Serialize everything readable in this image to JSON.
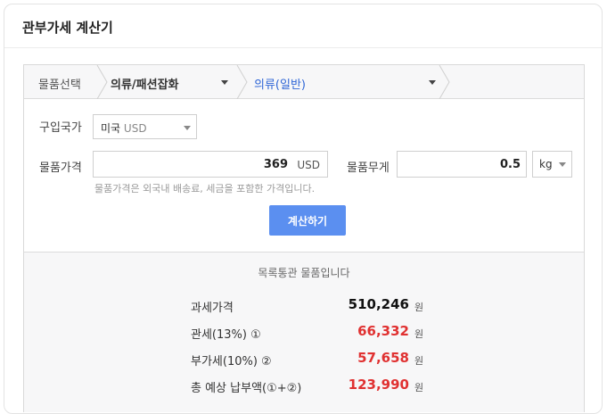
{
  "title": "관부가세 계산기",
  "breadcrumb": {
    "label": "물품선택",
    "category": "의류/패션잡화",
    "subcategory": "의류(일반)"
  },
  "form": {
    "country_label": "구입국가",
    "country_value": "미국",
    "country_currency": "USD",
    "price_label": "물품가격",
    "price_value": "369",
    "price_unit": "USD",
    "price_hint": "물품가격은 외국내 배송료, 세금을 포함한 가격입니다.",
    "weight_label": "물품무게",
    "weight_value": "0.5",
    "weight_unit": "kg",
    "calc_button": "계산하기"
  },
  "result": {
    "status": "목록통관 물품입니다",
    "rows": [
      {
        "label": "과세가격",
        "value": "510,246",
        "unit": "원"
      },
      {
        "label": "관세(13%) ①",
        "value": "66,332",
        "unit": "원"
      },
      {
        "label": "부가세(10%) ②",
        "value": "57,658",
        "unit": "원"
      },
      {
        "label": "총 예상 납부액(①+②)",
        "value": "123,990",
        "unit": "원"
      }
    ]
  },
  "colors": {
    "accent_button": "#5b8ff0",
    "link_blue": "#2f66d6",
    "amount_red": "#e03131"
  }
}
